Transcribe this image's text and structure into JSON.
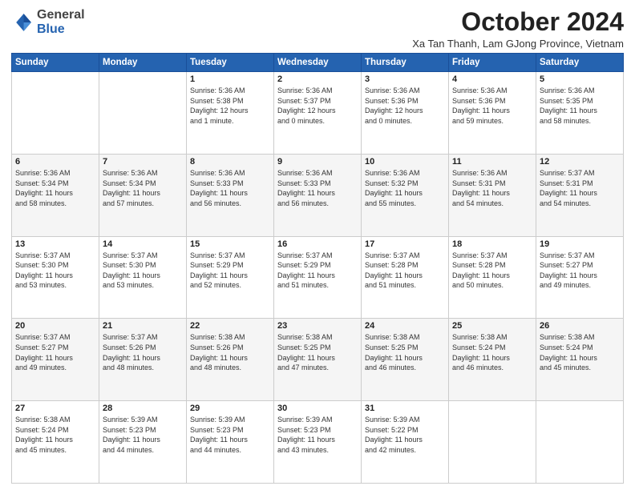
{
  "logo": {
    "general": "General",
    "blue": "Blue"
  },
  "title": "October 2024",
  "subtitle": "Xa Tan Thanh, Lam GJong Province, Vietnam",
  "days_header": [
    "Sunday",
    "Monday",
    "Tuesday",
    "Wednesday",
    "Thursday",
    "Friday",
    "Saturday"
  ],
  "weeks": [
    [
      {
        "day": "",
        "info": ""
      },
      {
        "day": "",
        "info": ""
      },
      {
        "day": "1",
        "info": "Sunrise: 5:36 AM\nSunset: 5:38 PM\nDaylight: 12 hours\nand 1 minute."
      },
      {
        "day": "2",
        "info": "Sunrise: 5:36 AM\nSunset: 5:37 PM\nDaylight: 12 hours\nand 0 minutes."
      },
      {
        "day": "3",
        "info": "Sunrise: 5:36 AM\nSunset: 5:36 PM\nDaylight: 12 hours\nand 0 minutes."
      },
      {
        "day": "4",
        "info": "Sunrise: 5:36 AM\nSunset: 5:36 PM\nDaylight: 11 hours\nand 59 minutes."
      },
      {
        "day": "5",
        "info": "Sunrise: 5:36 AM\nSunset: 5:35 PM\nDaylight: 11 hours\nand 58 minutes."
      }
    ],
    [
      {
        "day": "6",
        "info": "Sunrise: 5:36 AM\nSunset: 5:34 PM\nDaylight: 11 hours\nand 58 minutes."
      },
      {
        "day": "7",
        "info": "Sunrise: 5:36 AM\nSunset: 5:34 PM\nDaylight: 11 hours\nand 57 minutes."
      },
      {
        "day": "8",
        "info": "Sunrise: 5:36 AM\nSunset: 5:33 PM\nDaylight: 11 hours\nand 56 minutes."
      },
      {
        "day": "9",
        "info": "Sunrise: 5:36 AM\nSunset: 5:33 PM\nDaylight: 11 hours\nand 56 minutes."
      },
      {
        "day": "10",
        "info": "Sunrise: 5:36 AM\nSunset: 5:32 PM\nDaylight: 11 hours\nand 55 minutes."
      },
      {
        "day": "11",
        "info": "Sunrise: 5:36 AM\nSunset: 5:31 PM\nDaylight: 11 hours\nand 54 minutes."
      },
      {
        "day": "12",
        "info": "Sunrise: 5:37 AM\nSunset: 5:31 PM\nDaylight: 11 hours\nand 54 minutes."
      }
    ],
    [
      {
        "day": "13",
        "info": "Sunrise: 5:37 AM\nSunset: 5:30 PM\nDaylight: 11 hours\nand 53 minutes."
      },
      {
        "day": "14",
        "info": "Sunrise: 5:37 AM\nSunset: 5:30 PM\nDaylight: 11 hours\nand 53 minutes."
      },
      {
        "day": "15",
        "info": "Sunrise: 5:37 AM\nSunset: 5:29 PM\nDaylight: 11 hours\nand 52 minutes."
      },
      {
        "day": "16",
        "info": "Sunrise: 5:37 AM\nSunset: 5:29 PM\nDaylight: 11 hours\nand 51 minutes."
      },
      {
        "day": "17",
        "info": "Sunrise: 5:37 AM\nSunset: 5:28 PM\nDaylight: 11 hours\nand 51 minutes."
      },
      {
        "day": "18",
        "info": "Sunrise: 5:37 AM\nSunset: 5:28 PM\nDaylight: 11 hours\nand 50 minutes."
      },
      {
        "day": "19",
        "info": "Sunrise: 5:37 AM\nSunset: 5:27 PM\nDaylight: 11 hours\nand 49 minutes."
      }
    ],
    [
      {
        "day": "20",
        "info": "Sunrise: 5:37 AM\nSunset: 5:27 PM\nDaylight: 11 hours\nand 49 minutes."
      },
      {
        "day": "21",
        "info": "Sunrise: 5:37 AM\nSunset: 5:26 PM\nDaylight: 11 hours\nand 48 minutes."
      },
      {
        "day": "22",
        "info": "Sunrise: 5:38 AM\nSunset: 5:26 PM\nDaylight: 11 hours\nand 48 minutes."
      },
      {
        "day": "23",
        "info": "Sunrise: 5:38 AM\nSunset: 5:25 PM\nDaylight: 11 hours\nand 47 minutes."
      },
      {
        "day": "24",
        "info": "Sunrise: 5:38 AM\nSunset: 5:25 PM\nDaylight: 11 hours\nand 46 minutes."
      },
      {
        "day": "25",
        "info": "Sunrise: 5:38 AM\nSunset: 5:24 PM\nDaylight: 11 hours\nand 46 minutes."
      },
      {
        "day": "26",
        "info": "Sunrise: 5:38 AM\nSunset: 5:24 PM\nDaylight: 11 hours\nand 45 minutes."
      }
    ],
    [
      {
        "day": "27",
        "info": "Sunrise: 5:38 AM\nSunset: 5:24 PM\nDaylight: 11 hours\nand 45 minutes."
      },
      {
        "day": "28",
        "info": "Sunrise: 5:39 AM\nSunset: 5:23 PM\nDaylight: 11 hours\nand 44 minutes."
      },
      {
        "day": "29",
        "info": "Sunrise: 5:39 AM\nSunset: 5:23 PM\nDaylight: 11 hours\nand 44 minutes."
      },
      {
        "day": "30",
        "info": "Sunrise: 5:39 AM\nSunset: 5:23 PM\nDaylight: 11 hours\nand 43 minutes."
      },
      {
        "day": "31",
        "info": "Sunrise: 5:39 AM\nSunset: 5:22 PM\nDaylight: 11 hours\nand 42 minutes."
      },
      {
        "day": "",
        "info": ""
      },
      {
        "day": "",
        "info": ""
      }
    ]
  ]
}
